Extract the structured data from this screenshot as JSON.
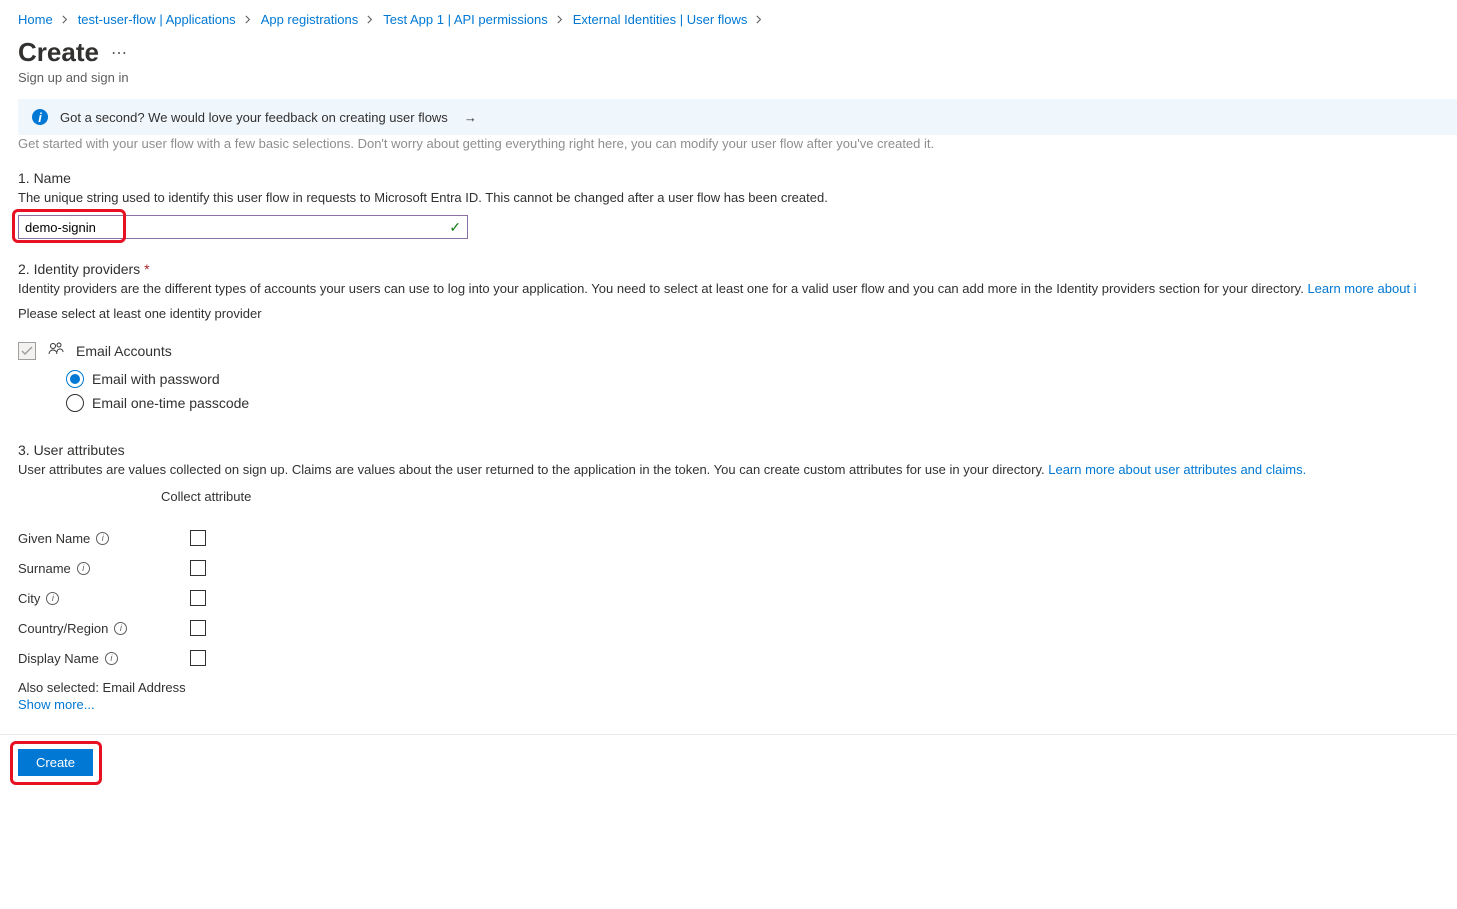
{
  "breadcrumb": [
    "Home",
    "test-user-flow | Applications",
    "App registrations",
    "Test App 1 | API permissions",
    "External Identities | User flows"
  ],
  "header": {
    "title": "Create",
    "subtitle": "Sign up and sign in"
  },
  "banner": {
    "text": "Got a second? We would love your feedback on creating user flows"
  },
  "intro": "Get started with your user flow with a few basic selections. Don't worry about getting everything right here, you can modify your user flow after you've created it.",
  "name_section": {
    "title": "1. Name",
    "desc": "The unique string used to identify this user flow in requests to Microsoft Entra ID. This cannot be changed after a user flow has been created.",
    "value": "demo-signin"
  },
  "idp_section": {
    "title": "2. Identity providers",
    "desc": "Identity providers are the different types of accounts your users can use to log into your application. You need to select at least one for a valid user flow and you can add more in the Identity providers section for your directory.",
    "learn_more": "Learn more about i",
    "select_prompt": "Please select at least one identity provider",
    "provider_label": "Email Accounts",
    "radio1": "Email with password",
    "radio2": "Email one-time passcode"
  },
  "attr_section": {
    "title": "3. User attributes",
    "desc": "User attributes are values collected on sign up. Claims are values about the user returned to the application in the token. You can create custom attributes for use in your directory.",
    "learn_more": "Learn more about user attributes and claims.",
    "col_header": "Collect attribute",
    "rows": [
      "Given Name",
      "Surname",
      "City",
      "Country/Region",
      "Display Name"
    ],
    "also_selected": "Also selected: Email Address",
    "show_more": "Show more..."
  },
  "footer": {
    "create": "Create"
  }
}
